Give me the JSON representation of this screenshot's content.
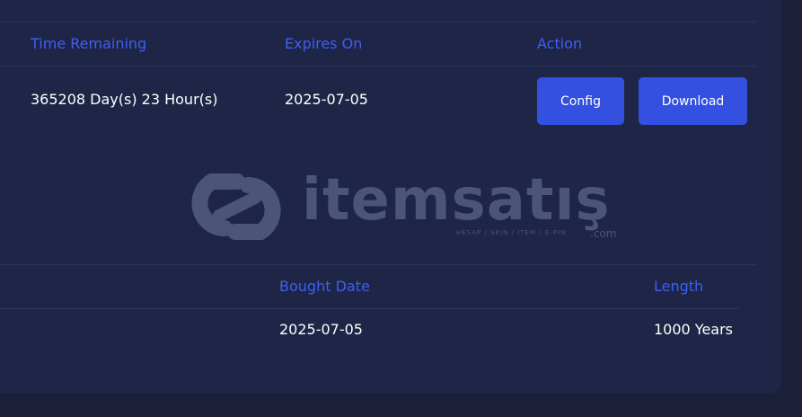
{
  "table1": {
    "headers": {
      "time_remaining": "Time Remaining",
      "expires_on": "Expires On",
      "action": "Action"
    },
    "row": {
      "time_remaining": "365208 Day(s) 23 Hour(s)",
      "expires_on": "2025-07-05"
    },
    "buttons": {
      "config": "Config",
      "download": "Download"
    }
  },
  "watermark": {
    "brand": "itemsatış",
    "tagline": "HESAP / SKIN / ITEM / E-PIN",
    "domain": ".com"
  },
  "table2": {
    "headers": {
      "bought_date": "Bought Date",
      "length": "Length"
    },
    "row": {
      "bought_date": "2025-07-05",
      "length": "1000 Years"
    }
  },
  "colors": {
    "background": "#1b1f3a",
    "panel": "#1e2546",
    "header_text": "#3f5ff2",
    "button": "#3350e0",
    "divider": "#2e3659",
    "watermark": "#4a5577"
  }
}
